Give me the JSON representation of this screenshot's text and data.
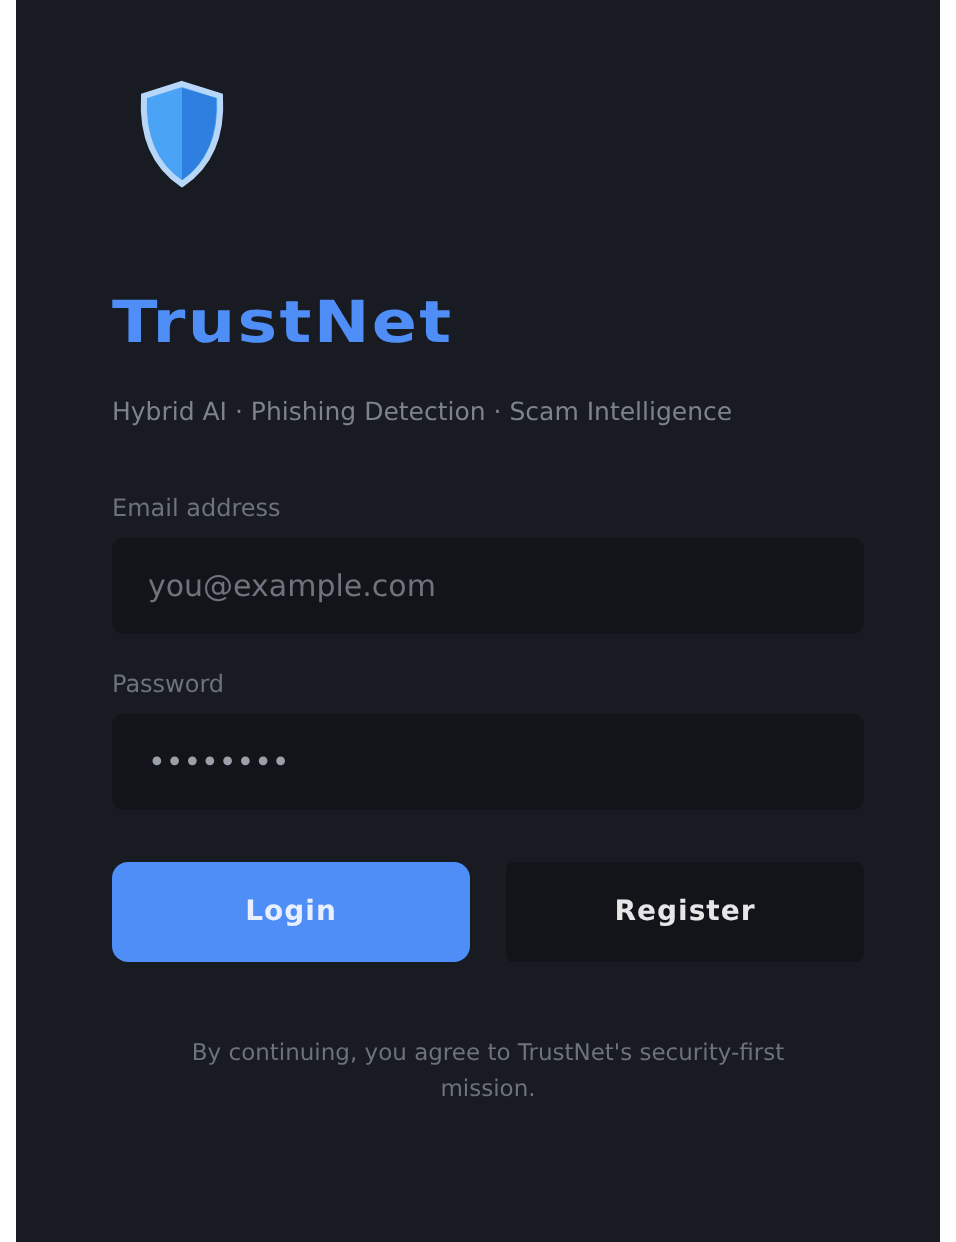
{
  "brand": {
    "title": "TrustNet",
    "tagline": "Hybrid AI · Phishing Detection · Scam Intelligence"
  },
  "fields": [
    {
      "label": "Email address",
      "placeholder": "you@example.com"
    },
    {
      "label": "Password",
      "value": "••••••••"
    }
  ],
  "buttons": [
    {
      "label": "Login",
      "kind": "primary"
    },
    {
      "label": "Register",
      "kind": "secondary"
    }
  ],
  "footer": "By continuing, you agree to TrustNet's security-first mission."
}
